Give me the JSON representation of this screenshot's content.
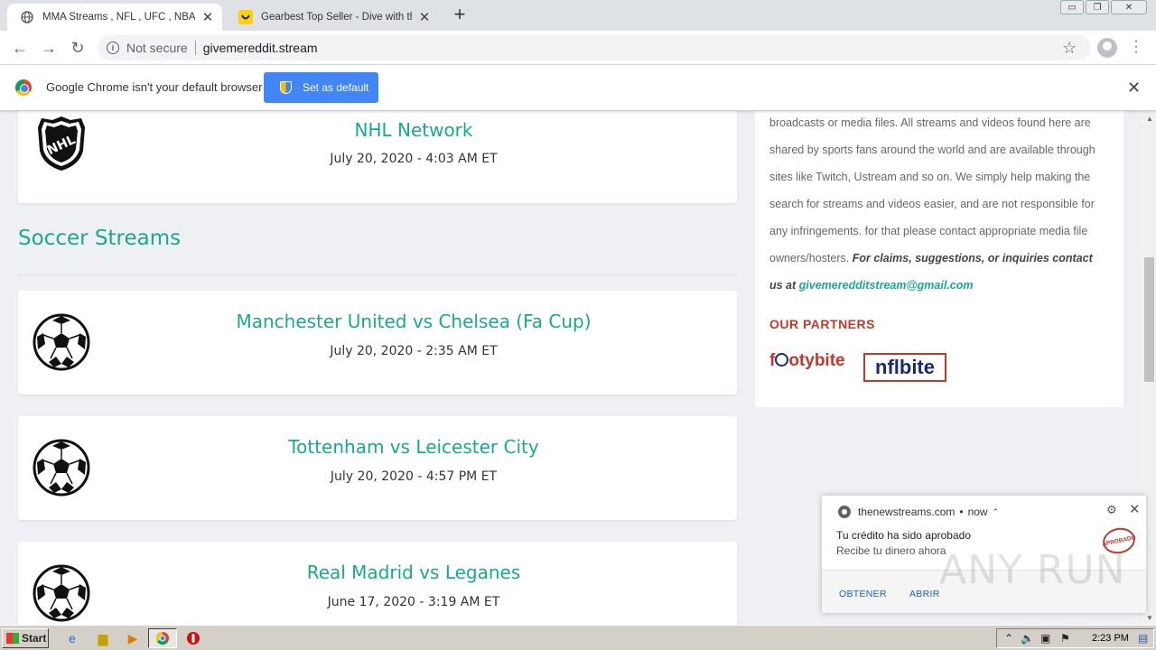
{
  "browser": {
    "tabs": [
      {
        "title": "MMA Streams , NFL , UFC , NBA , Bo",
        "active": true
      },
      {
        "title": "Gearbest Top Seller - Dive with the C",
        "active": false
      }
    ],
    "address": {
      "security": "Not secure",
      "url": "givemereddit.stream"
    },
    "infobar": {
      "message": "Google Chrome isn't your default browser",
      "button": "Set as default"
    }
  },
  "page": {
    "top_card": {
      "name": "NHL Network",
      "time": "July 20, 2020 - 4:03 AM ET",
      "logo": "nhl-logo"
    },
    "section": {
      "title": "Soccer Streams"
    },
    "matches": [
      {
        "name": "Manchester United vs Chelsea (Fa Cup)",
        "time": "July 20, 2020 - 2:35 AM ET"
      },
      {
        "name": "Tottenham vs Leicester City",
        "time": "July 20, 2020 - 4:57 PM ET"
      },
      {
        "name": "Real Madrid vs Leganes",
        "time": "June 17, 2020 - 3:19 AM ET"
      }
    ],
    "sidebar": {
      "disclaimer_lines": [
        "broadcasts or media files. All streams and videos found here are",
        "shared by sports fans around the world and are available through",
        "sites like Twitch, Ustream and so on. We simply help making the",
        "search for streams and videos easier, and are not responsible for",
        "any infringements. for that please contact appropriate media file"
      ],
      "last_line_plain": "owners/hosters.",
      "claims_text": "For claims, suggestions, or inquiries contact",
      "claims_prefix": "us at",
      "email": "givemeredditstream@gmail.com",
      "partners_title": "OUR PARTNERS",
      "partner1_pre": "f",
      "partner1_post": "otybite",
      "partner2": "nflbite"
    }
  },
  "notification": {
    "source": "thenewstreams.com",
    "when": "now",
    "title": "Tu crédito ha sido aprobado",
    "body": "Recibe tu dinero ahora",
    "stamp": "APROBADO",
    "actions": [
      "OBTENER",
      "ABRIR"
    ]
  },
  "watermark": "ANY RUN",
  "taskbar": {
    "start": "Start",
    "clock": "2:23 PM"
  },
  "colors": {
    "accent": "#19a98b",
    "partners": "#c0392b",
    "chrome_blue": "#4285f4"
  }
}
